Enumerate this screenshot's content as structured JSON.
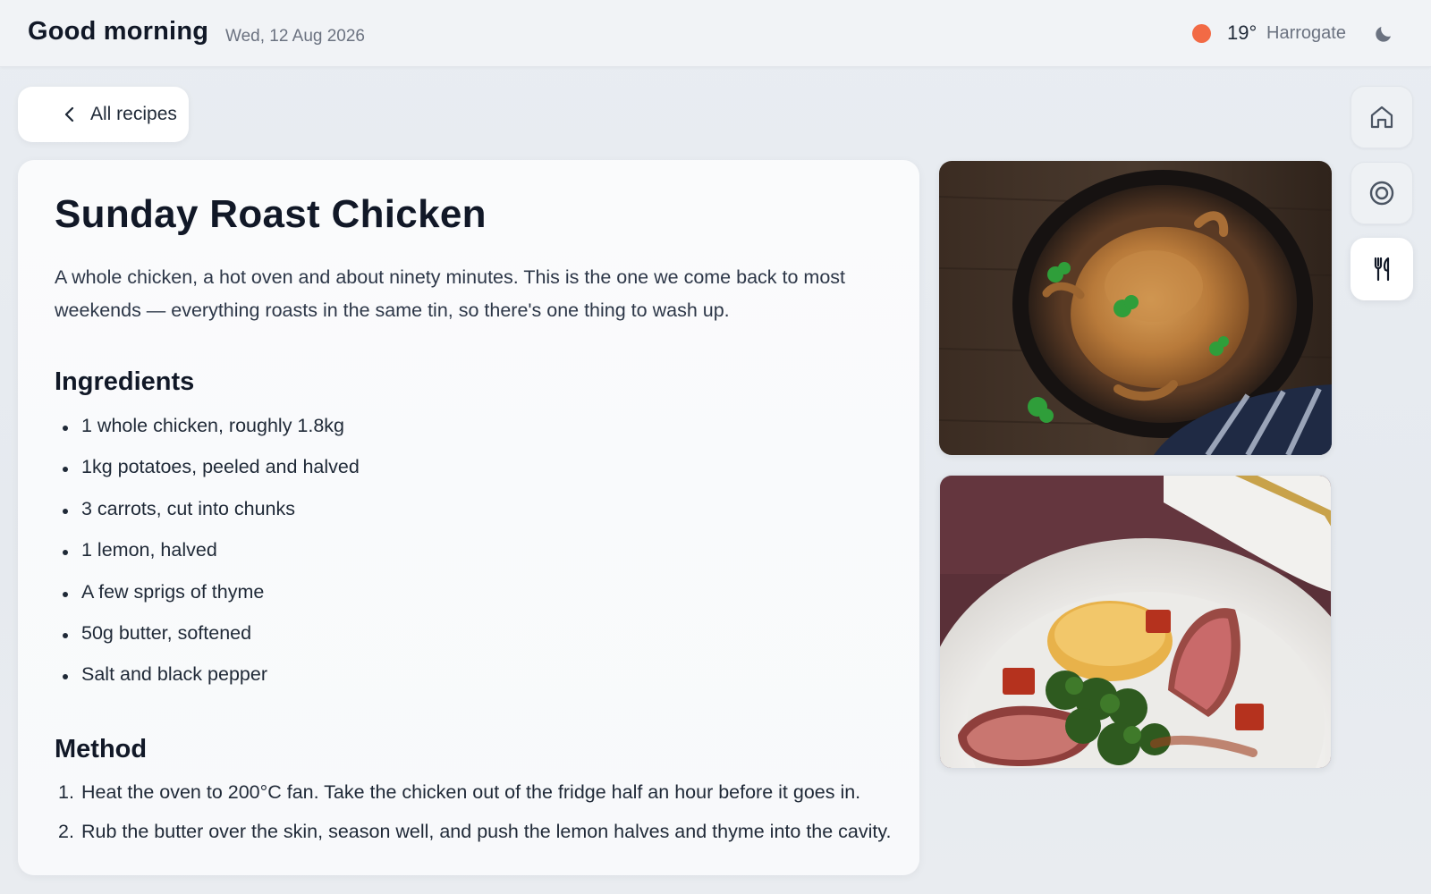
{
  "header": {
    "greeting": "Good morning",
    "date": "Wed, 12 Aug 2026",
    "weather": {
      "temperature": "19°",
      "location": "Harrogate",
      "status_color": "#f26a45",
      "icon": "sun-dot-icon"
    },
    "theme_icon": "moon-icon"
  },
  "back_button": {
    "label": "All recipes",
    "icon": "chevron-left-icon"
  },
  "recipe": {
    "title": "Sunday Roast Chicken",
    "intro": "A whole chicken, a hot oven and about ninety minutes. This is the one we come back to most weekends — everything roasts in the same tin, so there's one thing to wash up.",
    "ingredients_heading": "Ingredients",
    "ingredients": [
      "1 whole chicken, roughly 1.8kg",
      "1kg potatoes, peeled and halved",
      "3 carrots, cut into chunks",
      "1 lemon, halved",
      "A few sprigs of thyme",
      "50g butter, softened",
      "Salt and black pepper"
    ],
    "method_heading": "Method",
    "method": [
      {
        "num": "1.",
        "text": "Heat the oven to 200°C fan. Take the chicken out of the fridge half an hour before it goes in."
      },
      {
        "num": "2.",
        "text": "Rub the butter over the skin, season well, and push the lemon halves and thyme into the cavity."
      }
    ]
  },
  "photos": [
    {
      "subject": "roast-chicken-in-cast-iron-pan"
    },
    {
      "subject": "plated-duck-with-potato-and-greens"
    }
  ],
  "side_nav": [
    {
      "name": "home",
      "icon": "home-icon",
      "active": false
    },
    {
      "name": "target",
      "icon": "target-icon",
      "active": false
    },
    {
      "name": "recipes",
      "icon": "fork-knife-icon",
      "active": true
    }
  ],
  "colors": {
    "accent_weather": "#f26a45",
    "title_text": "#111827",
    "muted_text": "#6b7280"
  }
}
